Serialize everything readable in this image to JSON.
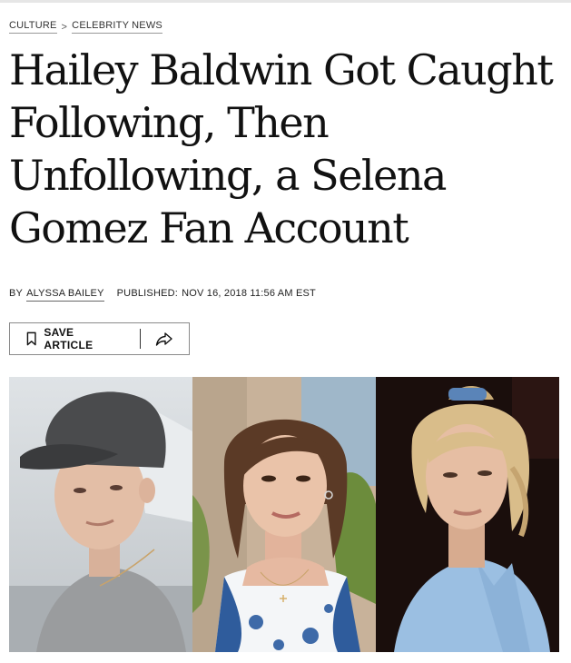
{
  "breadcrumb": {
    "items": [
      "CULTURE",
      "CELEBRITY NEWS"
    ],
    "separator": ">"
  },
  "article": {
    "headline": "Hailey Baldwin Got Caught Following, Then Unfollowing, a Selena Gomez Fan Account",
    "byline": {
      "by_label": "BY",
      "author": "ALYSSA BAILEY",
      "published_label": "PUBLISHED:",
      "published_date": "NOV 16, 2018 11:56 AM EST"
    }
  },
  "actions": {
    "save_label": "SAVE ARTICLE",
    "save_icon": "bookmark-icon",
    "share_icon": "share-arrow-icon"
  },
  "hero_image": {
    "panels": [
      "man-in-grey-cap-photo",
      "brunette-woman-floral-dress-photo",
      "blonde-woman-blue-shirt-photo"
    ]
  },
  "colors": {
    "text": "#111111",
    "border": "#8a8a8a",
    "topbar": "#e6e6e6"
  }
}
